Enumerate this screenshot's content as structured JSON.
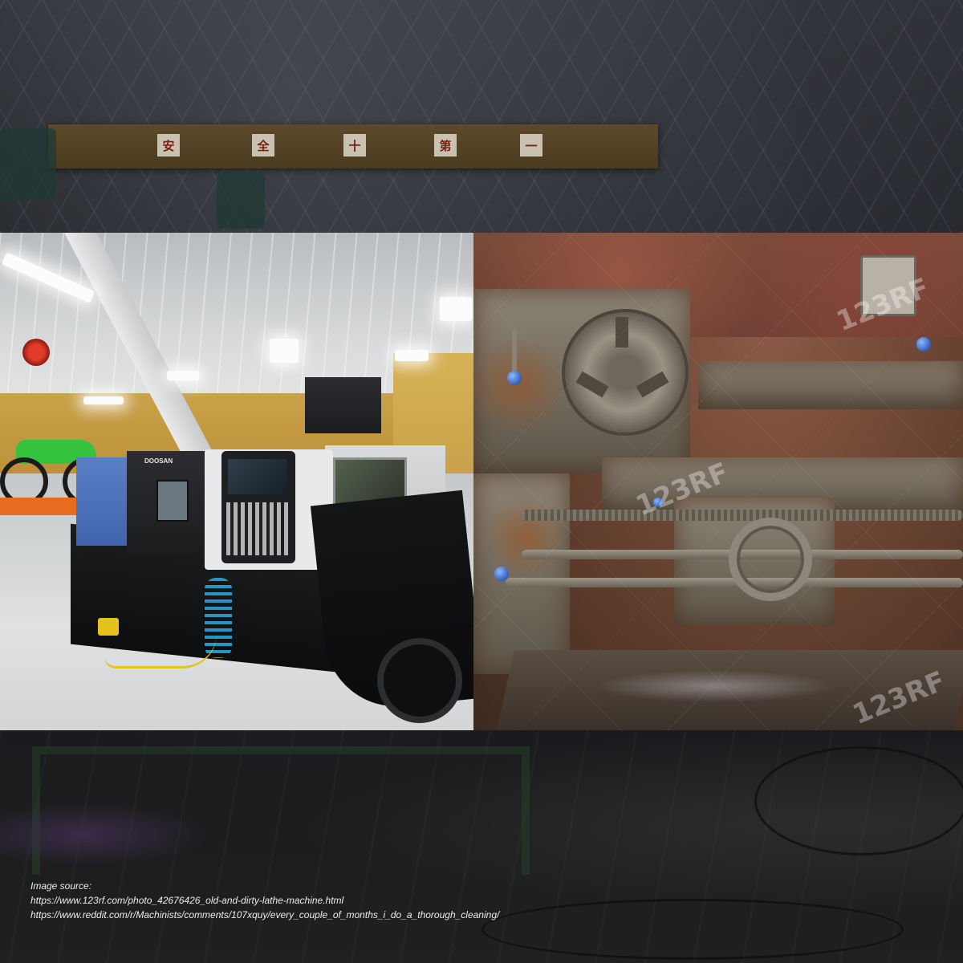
{
  "background": {
    "crane_signs": [
      "安",
      "全",
      "十",
      "第",
      "一"
    ]
  },
  "photos": {
    "left": {
      "brand_label": "DOOSAN"
    },
    "right": {
      "watermark": "123RF"
    }
  },
  "caption": {
    "heading": "Image source:",
    "lines": [
      "https://www.123rf.com/photo_42676426_old-and-dirty-lathe-machine.html",
      "https://www.reddit.com/r/Machinists/comments/107xquy/every_couple_of_months_i_do_a_thorough_cleaning/"
    ]
  },
  "colors": {
    "caption_text": "#ececec",
    "crane_beam": "#5c4a2a",
    "cnc_blue": "#5b7fc7",
    "rust": "#8b5a45",
    "knob_blue": "#2f5fb8"
  }
}
